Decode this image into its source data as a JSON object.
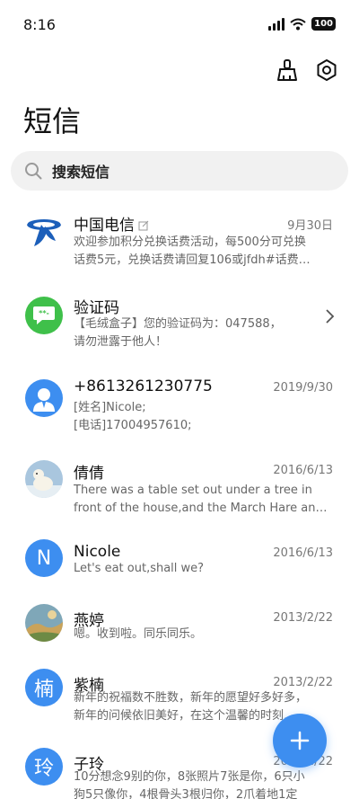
{
  "status_bar": {
    "time": "8:16",
    "battery": "100"
  },
  "top_actions": {
    "clean_icon": "broom-icon",
    "settings_icon": "gear-icon"
  },
  "page_title": "短信",
  "search": {
    "placeholder": "搜索短信"
  },
  "messages": [
    {
      "name": "中国电信",
      "date": "9月30日",
      "line1": "欢迎参加积分兑换话费活动，每500分可兑换",
      "line2": "话费5元，兑换话费请回复106或jfdh#话费…",
      "avatar": "china-telecom-logo"
    },
    {
      "name": "验证码",
      "date": "",
      "line1": "【毛绒盒子】您的验证码为：047588，",
      "line2": "请勿泄露于他人！",
      "avatar": "sms-code-icon"
    },
    {
      "name": "+8613261230775",
      "date": "2019/9/30",
      "line1": "[姓名]Nicole;",
      "line2": "[电话]17004957610;",
      "avatar": "person-icon"
    },
    {
      "name": "倩倩",
      "date": "2016/6/13",
      "line1": "There was a table set out under a tree in",
      "line2": "front of the house,and the March Hare an…",
      "avatar": "photo-polar-bear"
    },
    {
      "name": "Nicole",
      "date": "2016/6/13",
      "line1": "Let's eat out,shall we?",
      "line2": "",
      "avatar_letter": "N"
    },
    {
      "name": "燕婷",
      "date": "2013/2/22",
      "line1": "嗯。收到啦。同乐同乐。",
      "line2": "",
      "avatar": "photo-landscape"
    },
    {
      "name": "紫楠",
      "date": "2013/2/22",
      "line1": "新年的祝福数不胜数，新年的愿望好多好多，",
      "line2": "新年的问候依旧美好，在这个温馨的时刻…",
      "avatar_letter": "楠"
    },
    {
      "name": "子玲",
      "date": "2013/2/22",
      "line1": "10分想念9别的你，8张照片7张是你，6只小",
      "line2": "狗5只像你，4根骨头3根归你，2爪着地1定",
      "avatar_letter": "玲"
    }
  ],
  "fab": {
    "icon": "plus-icon"
  },
  "colors": {
    "accent": "#3d8ef0",
    "telecom_blue": "#1c5fba",
    "sms_green": "#3fc04a"
  }
}
